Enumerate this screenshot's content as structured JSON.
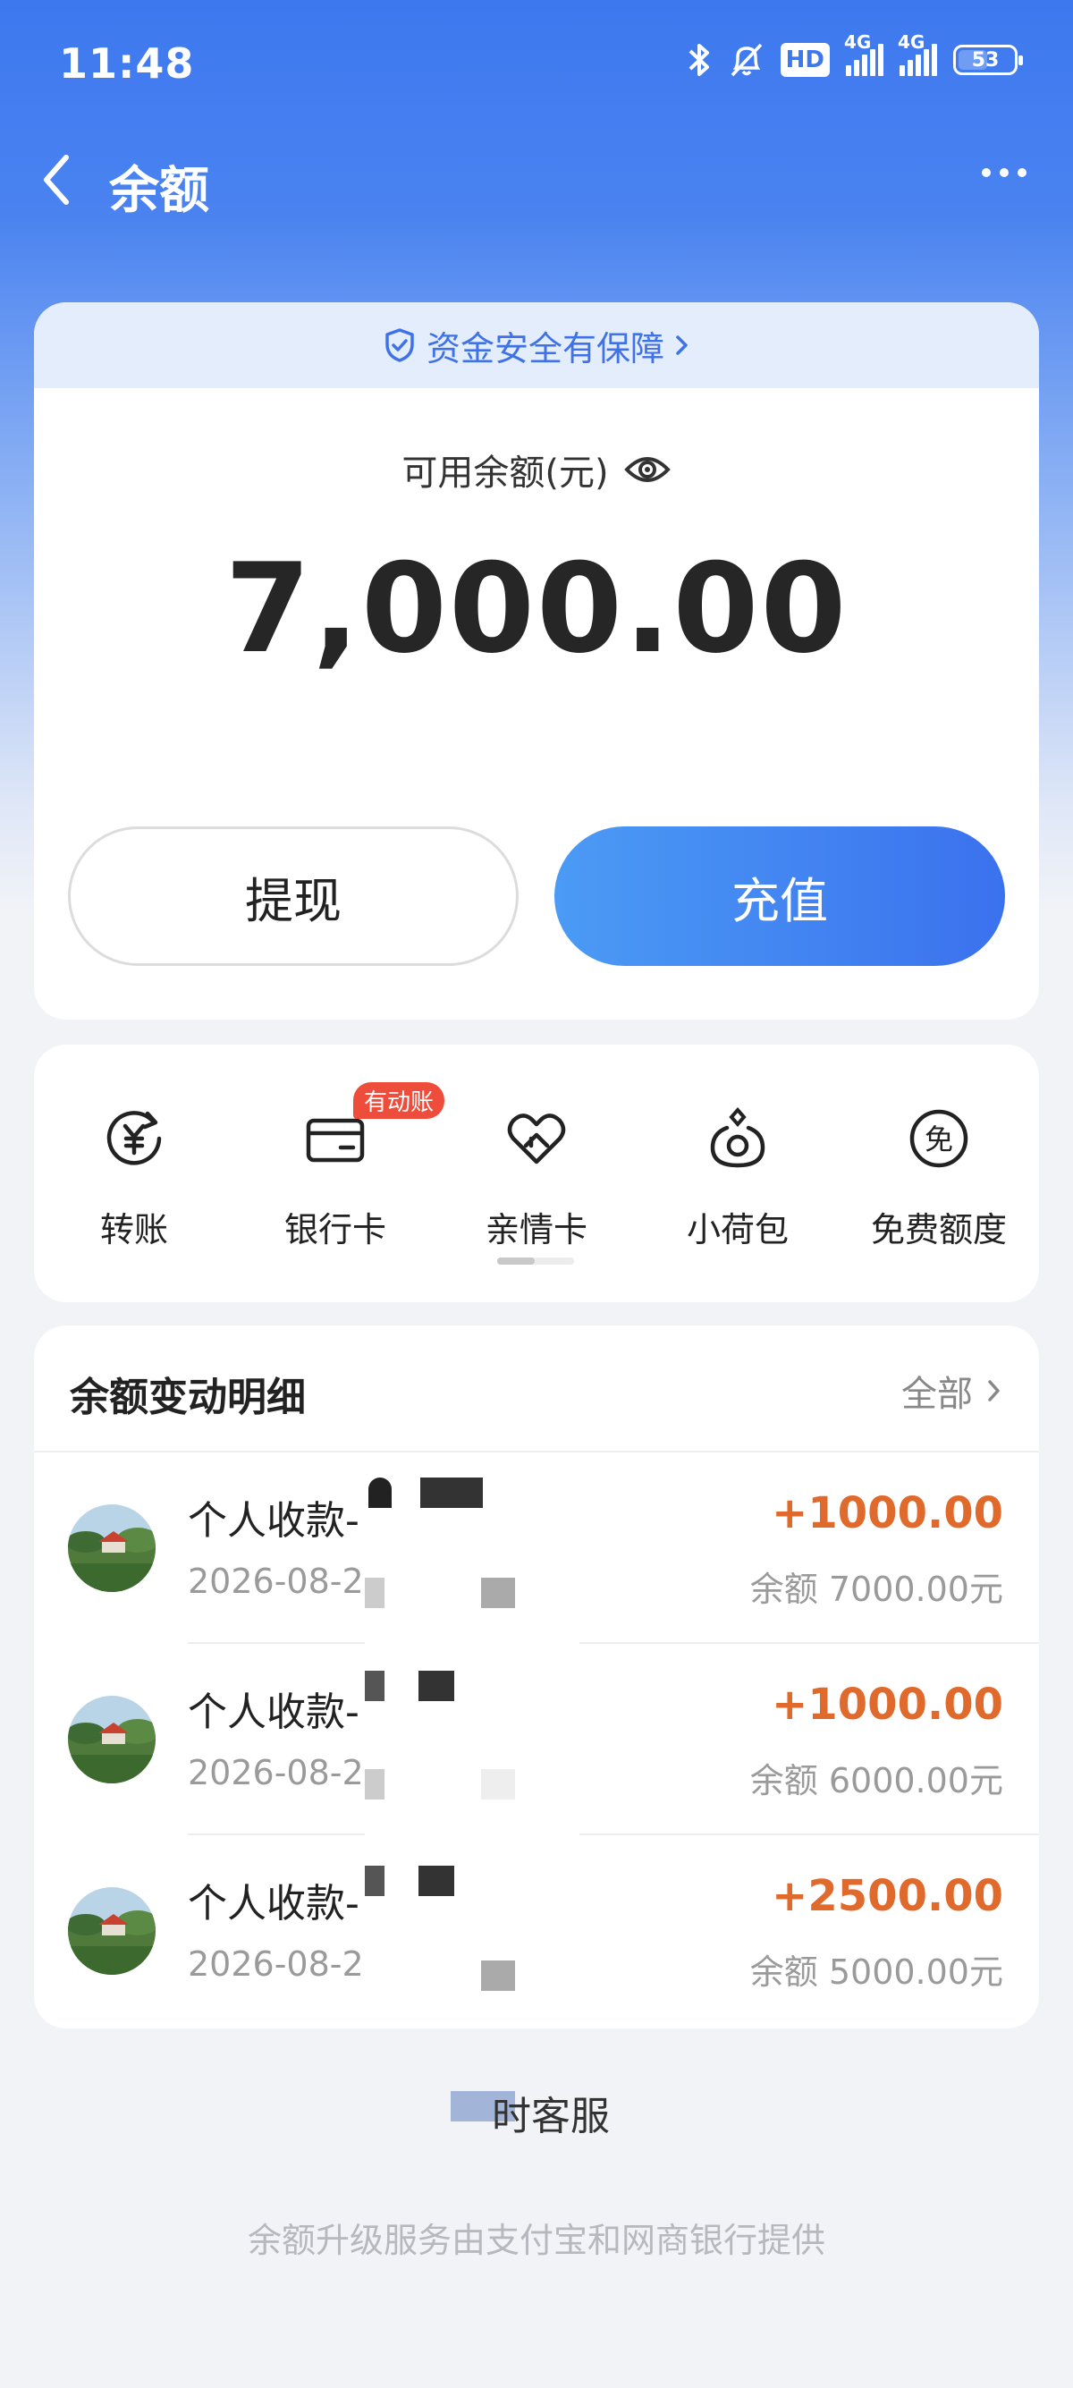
{
  "status_bar": {
    "time": "11:48",
    "hd_label": "HD",
    "net1": "4G",
    "net2": "4G",
    "battery": "53",
    "battery_level": 0.53
  },
  "nav": {
    "title": "余额"
  },
  "security": {
    "text": "资金安全有保障"
  },
  "balance": {
    "label": "可用余额(元)",
    "amount": "7,000.00",
    "withdraw_label": "提现",
    "recharge_label": "充值"
  },
  "services": {
    "items": [
      {
        "label": "转账",
        "icon": "transfer-yuan-icon"
      },
      {
        "label": "银行卡",
        "icon": "bank-card-icon",
        "badge": "有动账"
      },
      {
        "label": "亲情卡",
        "icon": "family-card-heart-icon"
      },
      {
        "label": "小荷包",
        "icon": "small-purse-icon"
      },
      {
        "label": "免费额度",
        "icon": "free-quota-icon",
        "icon_char": "免"
      }
    ]
  },
  "details": {
    "title": "余额变动明细",
    "all_label": "全部",
    "records": [
      {
        "name": "个人收款-",
        "date": "2026-08-2",
        "amount": "+1000.00",
        "balance": "余额 7000.00元"
      },
      {
        "name": "个人收款-",
        "date": "2026-08-2",
        "amount": "+1000.00",
        "balance": "余额 6000.00元"
      },
      {
        "name": "个人收款-",
        "date": "2026-08-28",
        "amount": "+2500.00",
        "balance": "余额 5000.00元"
      }
    ]
  },
  "service_link": "时客服",
  "footer": "余额升级服务由支付宝和网商银行提供",
  "colors": {
    "primary": "#3d78ef",
    "income": "#e06a2c",
    "badge": "#ef4d3b"
  }
}
